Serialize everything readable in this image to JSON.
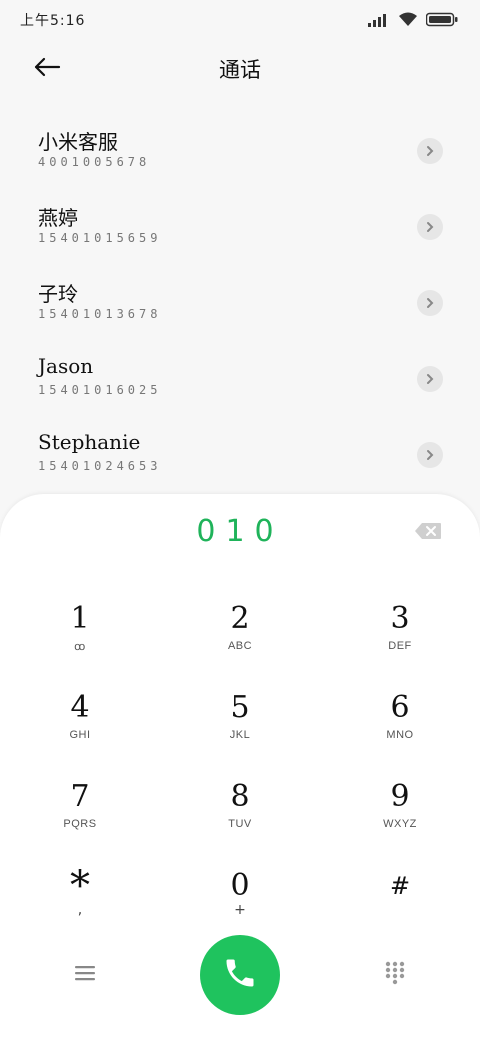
{
  "status_bar": {
    "time": "上午5:16",
    "icons": [
      "dnd-icon",
      "signal-icon",
      "wifi-icon",
      "battery-icon"
    ]
  },
  "header": {
    "title": "通话",
    "back_icon": "arrow-left-icon"
  },
  "contacts": [
    {
      "name": "小米客服",
      "number": "4001005678"
    },
    {
      "name": "燕婷",
      "number": "15401015659"
    },
    {
      "name": "子玲",
      "number": "15401013678"
    },
    {
      "name": "Jason",
      "number": "15401016025"
    },
    {
      "name": "Stephanie",
      "number": "15401024653"
    }
  ],
  "dialpad": {
    "dialed_number": "010",
    "backspace_icon": "backspace-icon",
    "keys": [
      [
        {
          "digit": "1",
          "letters": "",
          "sub": "ꝏ"
        },
        {
          "digit": "2",
          "letters": "ABC",
          "sub": ""
        },
        {
          "digit": "3",
          "letters": "DEF",
          "sub": ""
        }
      ],
      [
        {
          "digit": "4",
          "letters": "GHI",
          "sub": ""
        },
        {
          "digit": "5",
          "letters": "JKL",
          "sub": ""
        },
        {
          "digit": "6",
          "letters": "MNO",
          "sub": ""
        }
      ],
      [
        {
          "digit": "7",
          "letters": "PQRS",
          "sub": ""
        },
        {
          "digit": "8",
          "letters": "TUV",
          "sub": ""
        },
        {
          "digit": "9",
          "letters": "WXYZ",
          "sub": ""
        }
      ],
      [
        {
          "digit": "*",
          "letters": "",
          "sub": ","
        },
        {
          "digit": "0",
          "letters": "",
          "sub": "+"
        },
        {
          "digit": "#",
          "letters": "",
          "sub": ""
        }
      ]
    ]
  },
  "bottom_bar": {
    "menu_icon": "menu-icon",
    "call_icon": "phone-icon",
    "keypad_icon": "dialpad-icon"
  },
  "colors": {
    "accent_green": "#1fc35e",
    "background": "#f7f7f7",
    "dialpad_bg": "#ffffff"
  }
}
